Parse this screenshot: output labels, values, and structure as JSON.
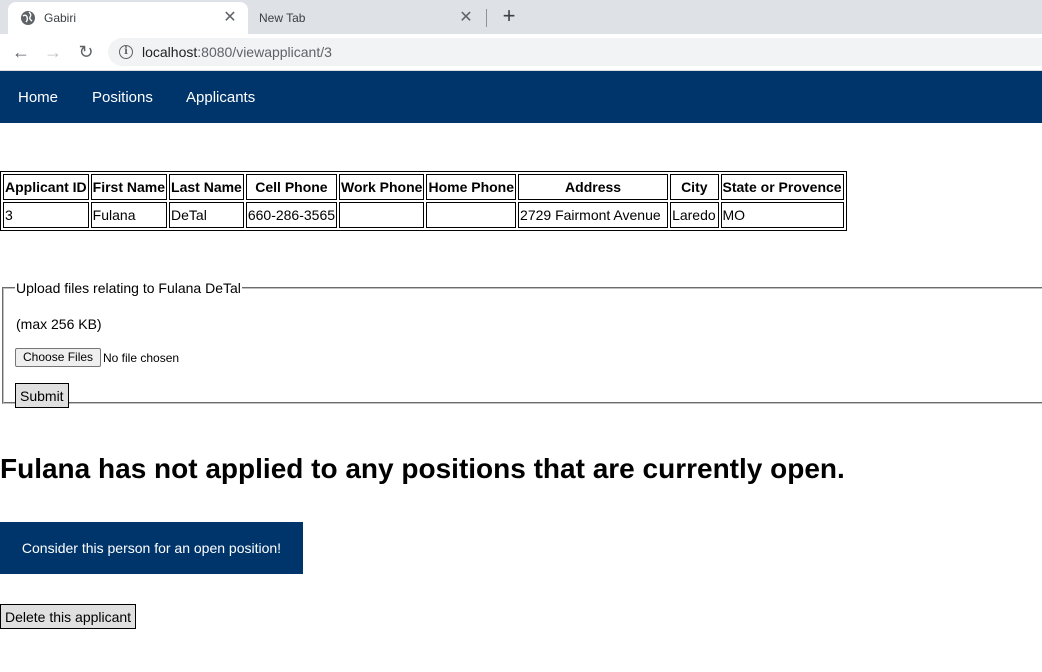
{
  "browser": {
    "tabs": [
      {
        "title": "Gabiri",
        "favicon": "globe-icon",
        "active": true
      },
      {
        "title": "New Tab",
        "active": false
      }
    ],
    "close_glyph": "✕",
    "new_tab_glyph": "+",
    "back_glyph": "←",
    "forward_glyph": "→",
    "reload_glyph": "↻",
    "info_glyph": "i",
    "url_host": "localhost",
    "url_path": ":8080/viewapplicant/3"
  },
  "nav": {
    "items": [
      "Home",
      "Positions",
      "Applicants"
    ],
    "color": "#00356b"
  },
  "applicant_table": {
    "headers": [
      "Applicant ID",
      "First Name",
      "Last Name",
      "Cell Phone",
      "Work Phone",
      "Home Phone",
      "Address",
      "City",
      "State or Provence"
    ],
    "rows": [
      [
        "3",
        "Fulana",
        "DeTal",
        "660-286-3565",
        "",
        "",
        "2729 Fairmont Avenue",
        "Laredo",
        "MO"
      ]
    ]
  },
  "upload": {
    "legend": "Upload files relating to Fulana DeTal",
    "max_size": "(max 256 KB)",
    "choose_label": "Choose Files",
    "file_status": "No file chosen",
    "submit_label": "Submit"
  },
  "no_positions_message": "Fulana has not applied to any positions that are currently open.",
  "consider_button": "Consider this person for an open position!",
  "delete_button": "Delete this applicant"
}
